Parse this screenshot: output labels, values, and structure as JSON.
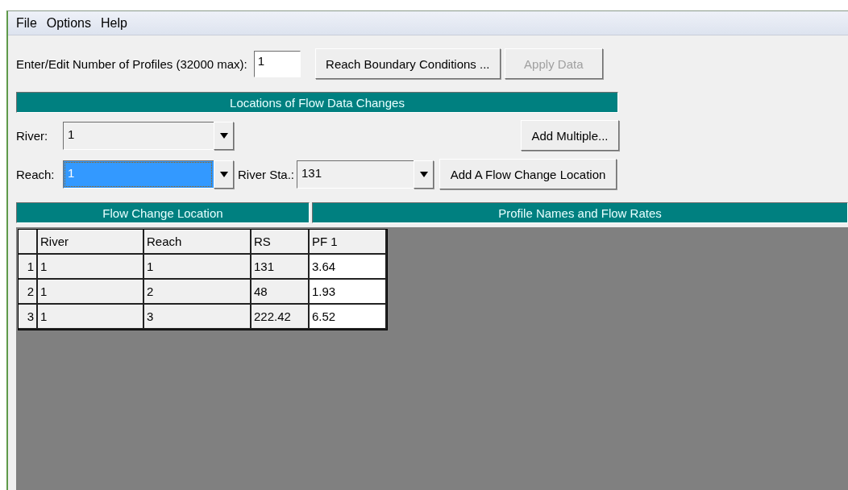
{
  "menu": [
    "File",
    "Options",
    "Help"
  ],
  "profiles": {
    "label": "Enter/Edit Number of Profiles (32000 max):",
    "value": "1"
  },
  "top_buttons": [
    {
      "label": "Reach Boundary Conditions ...",
      "disabled": false
    },
    {
      "label": "Apply Data",
      "disabled": true
    }
  ],
  "locations_header": "Locations of Flow Data Changes",
  "river": {
    "label": "River:",
    "value": "1",
    "focused": false
  },
  "add_multiple": {
    "label": "Add Multiple...",
    "disabled": false
  },
  "reach": {
    "label": "Reach:",
    "value": "1",
    "focused": true
  },
  "river_station": {
    "label": "River Sta.:",
    "value": "131",
    "focused": false
  },
  "add_location": {
    "label": "Add A Flow Change Location",
    "disabled": false
  },
  "table_headers": [
    "Flow Change Location",
    "Profile Names and Flow Rates"
  ],
  "table": {
    "columns": [
      {
        "label": "River",
        "editable": false
      },
      {
        "label": "Reach",
        "editable": false
      },
      {
        "label": "RS",
        "editable": false
      },
      {
        "label": "PF 1",
        "editable": true
      }
    ],
    "rows": [
      {
        "number": "1",
        "cells": [
          "1",
          "1",
          "131",
          "3.64"
        ]
      },
      {
        "number": "2",
        "cells": [
          "1",
          "2",
          "48",
          "1.93"
        ]
      },
      {
        "number": "3",
        "cells": [
          "1",
          "3",
          "222.42",
          "6.52"
        ]
      }
    ]
  }
}
